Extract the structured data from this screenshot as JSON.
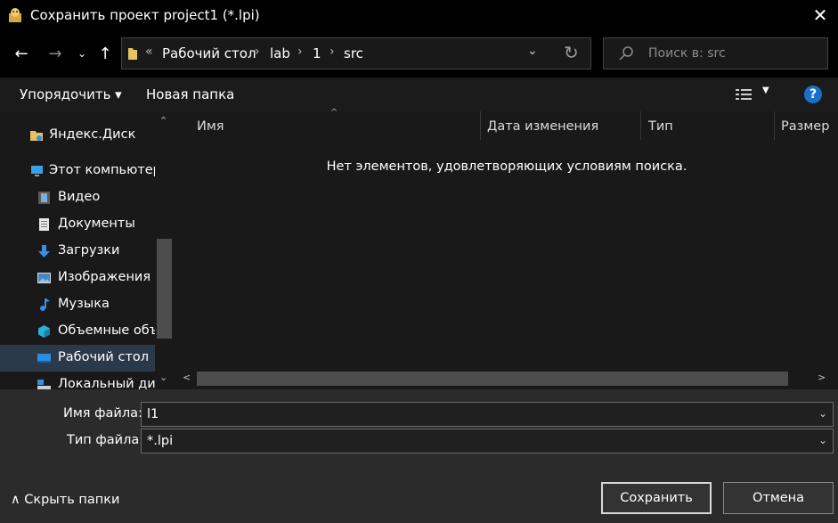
{
  "window": {
    "title": "Сохранить проект project1 (*.lpi)",
    "close_glyph": "✕"
  },
  "nav": {
    "back_glyph": "←",
    "forward_glyph": "→",
    "recent_glyph": "⌄",
    "up_glyph": "↑",
    "crumb_overflow": "«",
    "breadcrumbs": [
      "Рабочий стол",
      "lab",
      "1",
      "src"
    ],
    "breadcrumb_separator": "›",
    "address_dropdown_glyph": "⌄",
    "refresh_glyph": "↻"
  },
  "search": {
    "placeholder": "Поиск в: src"
  },
  "toolbar": {
    "organize_label": "Упорядочить ▾",
    "new_folder_label": "Новая папка",
    "view_dropdown_glyph": "▼",
    "help_glyph": "?"
  },
  "sidebar": {
    "items": [
      {
        "label": "Яндекс.Диск",
        "icon": "yandex-disk-icon"
      },
      {
        "label": "Этот компьютер",
        "icon": "this-pc-icon"
      },
      {
        "label": "Видео",
        "icon": "video-icon"
      },
      {
        "label": "Документы",
        "icon": "documents-icon"
      },
      {
        "label": "Загрузки",
        "icon": "downloads-icon"
      },
      {
        "label": "Изображения",
        "icon": "pictures-icon"
      },
      {
        "label": "Музыка",
        "icon": "music-icon"
      },
      {
        "label": "Объемные объекты",
        "icon": "3d-objects-icon"
      },
      {
        "label": "Рабочий стол",
        "icon": "desktop-icon",
        "selected": true
      },
      {
        "label": "Локальный диск",
        "icon": "local-disk-icon"
      }
    ],
    "scroll_up_glyph": "⌃",
    "scroll_down_glyph": "⌄"
  },
  "file_list": {
    "columns": [
      "Имя",
      "Дата изменения",
      "Тип",
      "Размер"
    ],
    "sort_glyph": "^",
    "empty_message": "Нет элементов, удовлетворяющих условиям поиска.",
    "hscroll_left_glyph": "<",
    "hscroll_right_glyph": ">"
  },
  "form": {
    "filename_label": "Имя файла:",
    "filename_value": "l1",
    "filetype_label": "Тип файла:",
    "filetype_value": "*.lpi",
    "dropdown_glyph": "⌄"
  },
  "footer": {
    "hide_folders_label": "∧  Скрыть папки",
    "save_label": "Сохранить",
    "cancel_label": "Отмена"
  },
  "colors": {
    "accent": "#1a6ecc",
    "selection": "#2b3a4a",
    "folder": "#e8c260"
  }
}
